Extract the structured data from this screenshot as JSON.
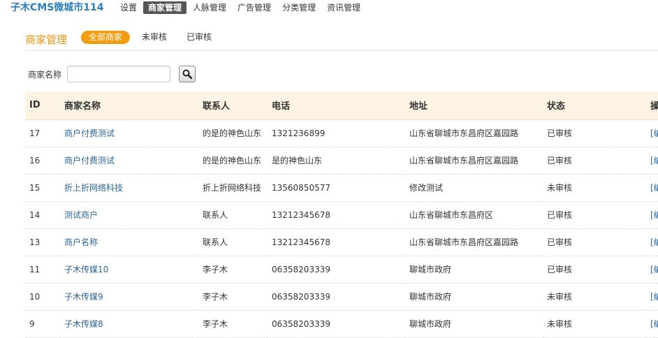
{
  "brand": "子木CMS微城市114",
  "nav": [
    "设置",
    "商家管理",
    "人脉管理",
    "广告管理",
    "分类管理",
    "资讯管理"
  ],
  "nav_active_index": 1,
  "section": {
    "title": "商家管理",
    "tabs": [
      "全部商家",
      "未审核",
      "已审核"
    ],
    "active_tab_index": 0
  },
  "search": {
    "label": "商家名称",
    "value": "",
    "placeholder": "",
    "button_icon": "search-icon"
  },
  "table": {
    "headers": [
      "ID",
      "商家名称",
      "联系人",
      "电话",
      "地址",
      "状态",
      "操"
    ],
    "rows": [
      {
        "id": "17",
        "name": "商户付费测试",
        "contact": "的是的神色山东",
        "phone": "1321236899",
        "address": "山东省聊城市东昌府区嘉园路",
        "status": "已审核",
        "op": "[编"
      },
      {
        "id": "16",
        "name": "商户付费测试",
        "contact": "的是的神色山东",
        "phone": "是的神色山东",
        "address": "山东省聊城市东昌府区嘉园路",
        "status": "已审核",
        "op": "[编"
      },
      {
        "id": "15",
        "name": "折上折网络科技",
        "contact": "折上折网络科技",
        "phone": "13560850577",
        "address": "修改测试",
        "status": "未审核",
        "op": "[编"
      },
      {
        "id": "14",
        "name": "测试商户",
        "contact": "联系人",
        "phone": "13212345678",
        "address": "山东省聊城市东昌府区",
        "status": "已审核",
        "op": "[编"
      },
      {
        "id": "13",
        "name": "商户名称",
        "contact": "联系人",
        "phone": "13212345678",
        "address": "山东省聊城市东昌府区嘉园路",
        "status": "已审核",
        "op": "[编"
      },
      {
        "id": "11",
        "name": "子木传媒10",
        "contact": "李子木",
        "phone": "06358203339",
        "address": "聊城市政府",
        "status": "已审核",
        "op": "[编"
      },
      {
        "id": "10",
        "name": "子木传媒9",
        "contact": "李子木",
        "phone": "06358203339",
        "address": "聊城市政府",
        "status": "未审核",
        "op": "[编"
      },
      {
        "id": "9",
        "name": "子木传媒8",
        "contact": "李子木",
        "phone": "06358203339",
        "address": "聊城市政府",
        "status": "未审核",
        "op": "[编"
      }
    ]
  },
  "colors": {
    "brand": "#2b7fbf",
    "section_title": "#e8940f",
    "active_tab": "#f39c12",
    "active_nav": "#555555",
    "link": "#2a6496",
    "header_bg": "#fdf3e3"
  }
}
